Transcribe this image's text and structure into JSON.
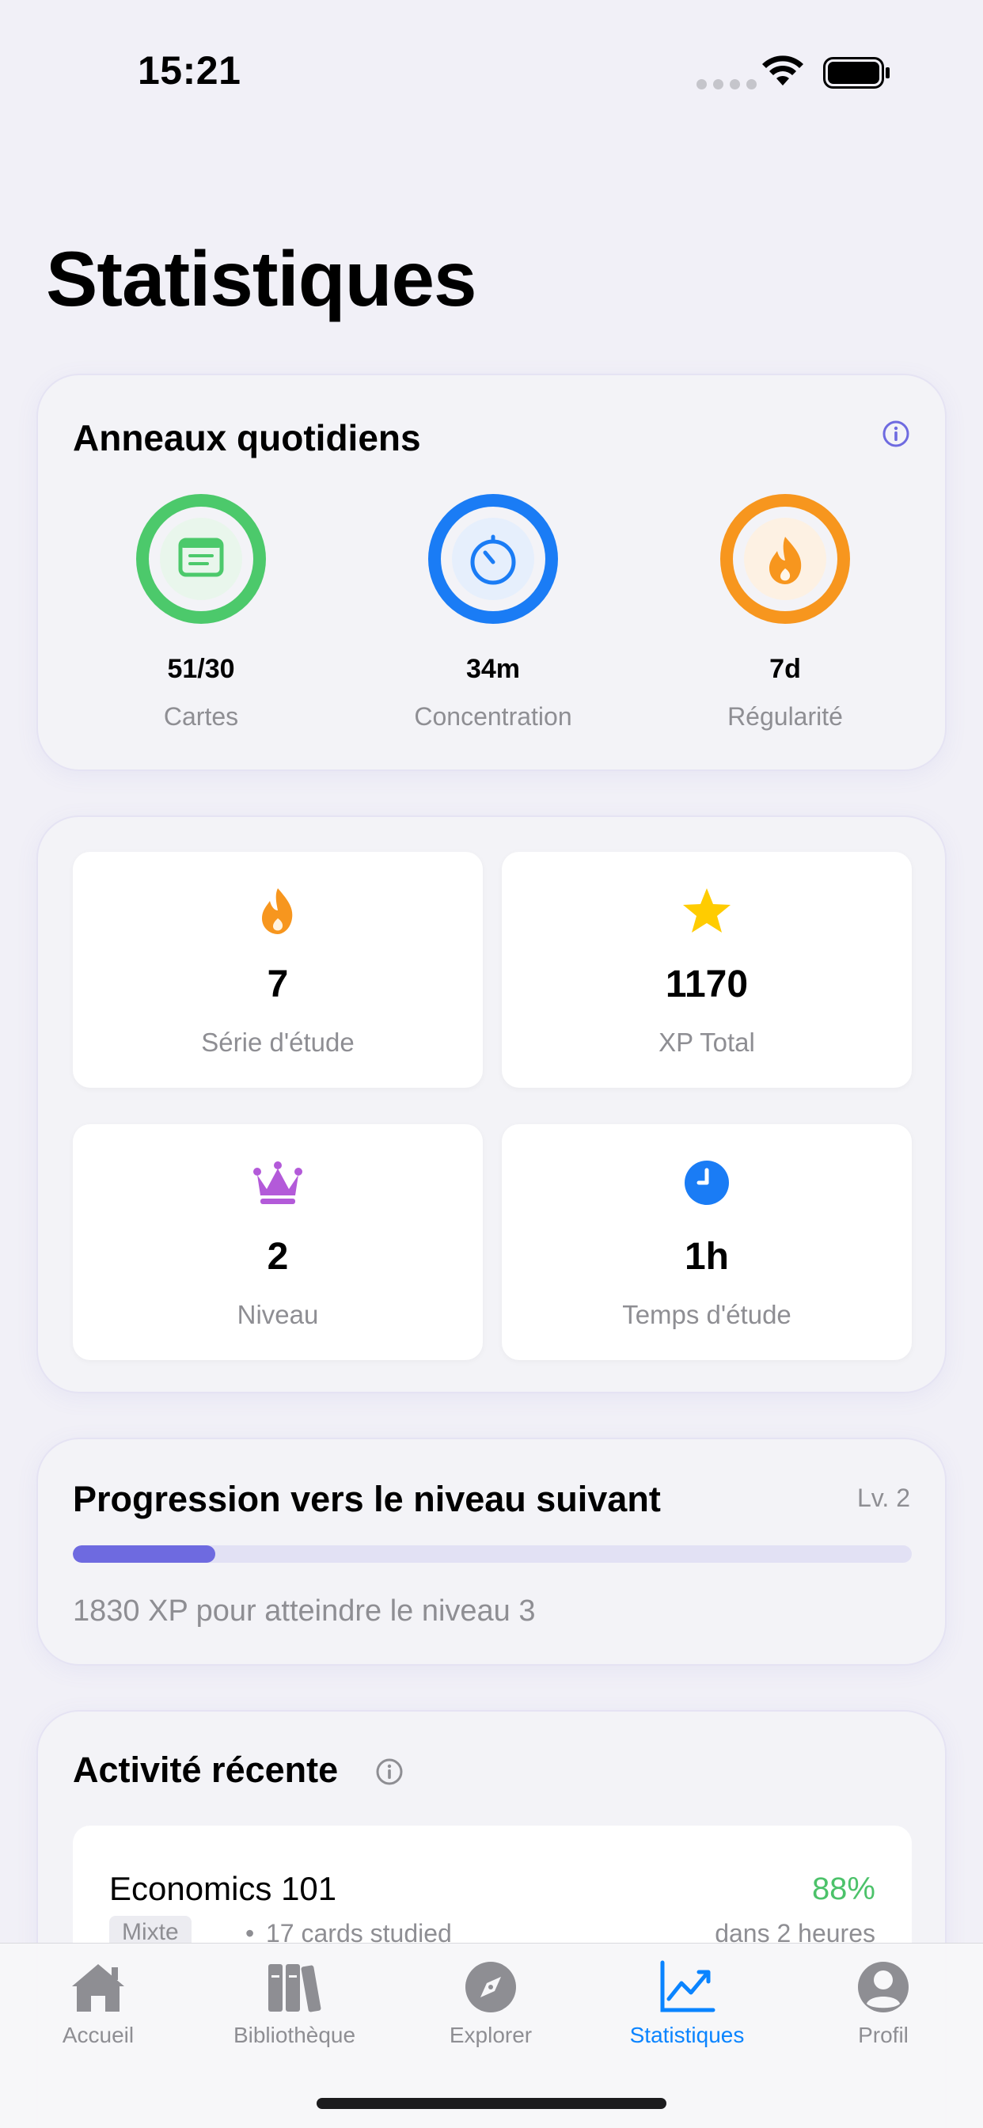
{
  "status_bar": {
    "time": "15:21"
  },
  "page": {
    "title": "Statistiques"
  },
  "rings": {
    "title": "Anneaux quotidiens",
    "items": [
      {
        "value": "51/30",
        "label": "Cartes",
        "color": "#4cc96b",
        "icon": "cards-icon",
        "progress": 1.0
      },
      {
        "value": "34m",
        "label": "Concentration",
        "color": "#1a7cf5",
        "icon": "timer-icon",
        "progress": 1.0
      },
      {
        "value": "7d",
        "label": "Régularité",
        "color": "#f7961e",
        "icon": "flame-icon",
        "progress": 1.0
      }
    ]
  },
  "stats": [
    {
      "value": "7",
      "label": "Série d'étude",
      "icon": "flame-icon",
      "color": "#f7961e"
    },
    {
      "value": "1170",
      "label": "XP Total",
      "icon": "star-icon",
      "color": "#ffcc00"
    },
    {
      "value": "2",
      "label": "Niveau",
      "icon": "crown-icon",
      "color": "#b35ad9"
    },
    {
      "value": "1h",
      "label": "Temps d'étude",
      "icon": "clock-icon",
      "color": "#1a7cf5"
    }
  ],
  "progress": {
    "title": "Progression vers le niveau suivant",
    "level": "Lv. 2",
    "fraction": 0.17,
    "caption": "1830 XP pour atteindre le niveau 3",
    "color": "#6e6ae0"
  },
  "activity": {
    "title": "Activité récente",
    "items": [
      {
        "name": "Economics 101",
        "score": "88%",
        "tag": "Mixte",
        "separator": "•",
        "cards": "17 cards studied",
        "time": "dans 2 heures"
      }
    ]
  },
  "tabs": [
    {
      "label": "Accueil",
      "icon": "house-icon",
      "active": false
    },
    {
      "label": "Bibliothèque",
      "icon": "books-icon",
      "active": false
    },
    {
      "label": "Explorer",
      "icon": "compass-icon",
      "active": false
    },
    {
      "label": "Statistiques",
      "icon": "chart-icon",
      "active": true
    },
    {
      "label": "Profil",
      "icon": "person-icon",
      "active": false
    }
  ],
  "colors": {
    "accent": "#0a84ff",
    "background": "#f1f0f7",
    "muted": "#8e8e93",
    "success": "#4cc26a"
  }
}
